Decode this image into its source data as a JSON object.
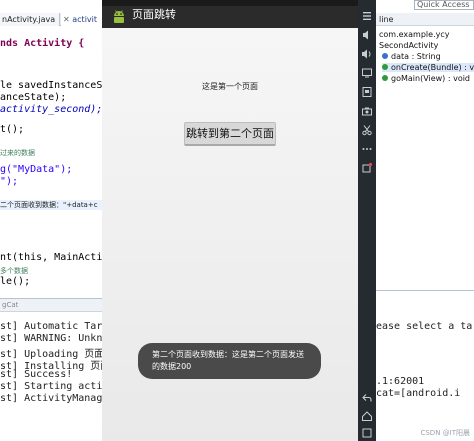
{
  "editor": {
    "tabs": [
      {
        "label": "nActivity.java"
      },
      {
        "label": "activit"
      }
    ],
    "close_glyph": "✕",
    "code_lines": [
      {
        "text": "nds Activity {"
      },
      {
        "text": "le savedInstanceSt"
      },
      {
        "text": "anceState);"
      },
      {
        "text": "activity_second);"
      },
      {
        "text": "t();"
      },
      {
        "text": "过来的数据"
      },
      {
        "text": "g(\"MyData\");"
      },
      {
        "text": "\");"
      },
      {
        "text": "二个页面收到数据：\"+data+c"
      },
      {
        "text": "nt(this, MainActiv"
      },
      {
        "text": "多个数据"
      },
      {
        "text": "le();"
      }
    ]
  },
  "console": {
    "header": "gCat",
    "lines": [
      {
        "text": "st] Automatic Targe"
      },
      {
        "text": "st] WARNING: Unknow"
      },
      {
        "text": "st] Uploading 页面跳转"
      },
      {
        "text": "st] Installing 页面跳"
      },
      {
        "text": "st] Success!"
      },
      {
        "text": "st] Starting activi"
      },
      {
        "text": "st] ActivityManager"
      }
    ]
  },
  "emulator": {
    "app_title": "页面跳转",
    "page_label": "这是第一个页面",
    "button_label": "跳转到第二个页面",
    "toast_text": "第二个页面收到数据：这是第二个页面发送的数据200"
  },
  "emulator_side_icons": [
    "menu-icon",
    "volume-down-icon",
    "volume-up-icon",
    "screen-icon",
    "screenshot-icon",
    "camera-icon",
    "cut-icon",
    "more-icon",
    "rotate-icon",
    "back-icon",
    "home-icon",
    "recents-icon"
  ],
  "outline": {
    "quick_access": "Quick Access",
    "tab_label": "line",
    "items": [
      {
        "text": "com.example.ycy"
      },
      {
        "text": "SecondActivity"
      },
      {
        "text": "data : String"
      },
      {
        "text": "onCreate(Bundle) : void"
      },
      {
        "text": "goMain(View) : void"
      }
    ],
    "console_lines": [
      {
        "text": "ease select a targ"
      },
      {
        "text": ".1:62001"
      },
      {
        "text": "cat=[android.i"
      }
    ],
    "watermark": "CSDN @IT阳晨"
  },
  "colors": {
    "action_bar": "#2b2b2b",
    "toast_bg": "#4a4a4a",
    "keyword": "#7f0055",
    "string": "#2a00ff"
  }
}
